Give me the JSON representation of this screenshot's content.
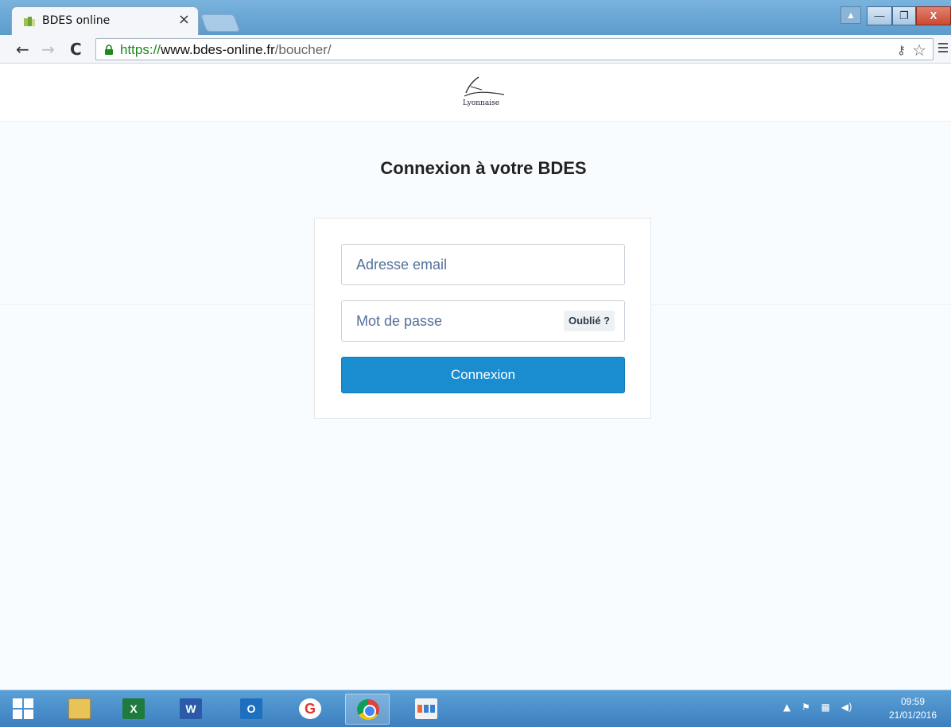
{
  "browser": {
    "tab_title": "BDES online",
    "tab_close": "×",
    "url_scheme": "https://",
    "url_host": "www.bdes-online.fr",
    "url_path": "/boucher/",
    "back_glyph": "←",
    "forward_glyph": "→",
    "reload_glyph": "C",
    "icons": [
      "favicon-icon",
      "lock-icon",
      "key-icon",
      "star-icon",
      "menu-icon"
    ]
  },
  "window_controls": {
    "user": "▲",
    "minimize": "—",
    "maximize": "❐",
    "close": "X"
  },
  "header": {
    "logo_text": "Lyonnaise"
  },
  "login": {
    "heading": "Connexion à votre BDES",
    "email_placeholder": "Adresse email",
    "password_placeholder": "Mot de passe",
    "forgot_label": "Oublié ?",
    "submit_label": "Connexion"
  },
  "colors": {
    "primary_button": "#1a8dd1",
    "secure_url": "#1b8a1b",
    "taskbar": "#4a8ccc"
  },
  "taskbar": {
    "clock_time": "09:59",
    "clock_date": "21/01/2016",
    "apps": [
      "windows-start",
      "file-explorer",
      "excel",
      "word",
      "outlook",
      "google",
      "chrome",
      "app"
    ]
  }
}
